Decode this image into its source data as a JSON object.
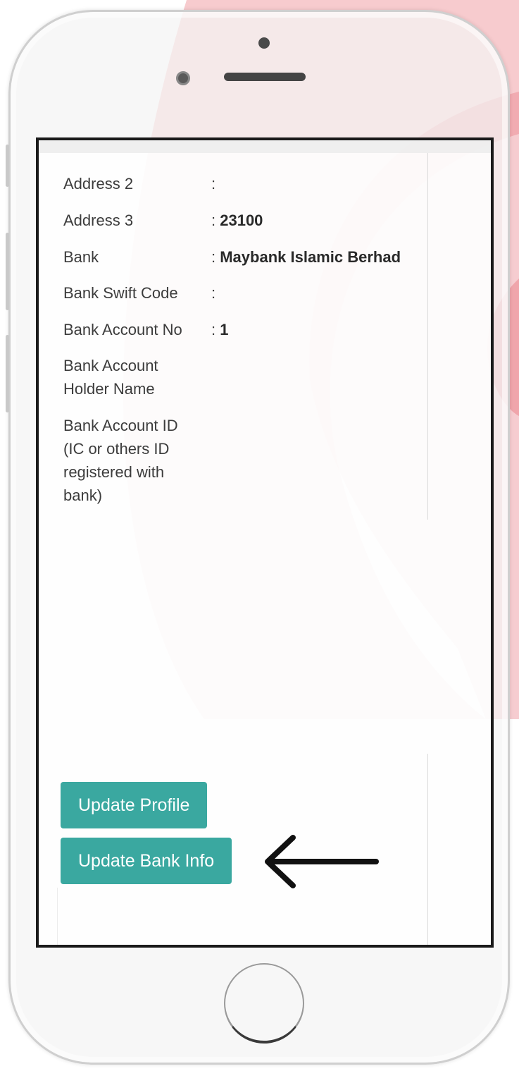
{
  "colors": {
    "button_bg": "#3aa8a0",
    "swirl": "#e8707a",
    "bezel": "#f4f4f4",
    "screen_border": "#1a1a1a",
    "arrow": "#111111"
  },
  "details": {
    "separator": ": ",
    "rows": [
      {
        "label": "Address 2",
        "value": ""
      },
      {
        "label": "Address 3",
        "value": "23100"
      },
      {
        "label": "Bank",
        "value": "Maybank Islamic Berhad"
      },
      {
        "label": "Bank Swift Code",
        "value": ""
      },
      {
        "label": "Bank Account No",
        "value": "1"
      },
      {
        "label_lines": [
          "Bank Account",
          "Holder Name"
        ],
        "value": ""
      },
      {
        "label_lines": [
          "Bank Account ID",
          "(IC or others ID",
          "registered with",
          "bank)"
        ],
        "value": ""
      }
    ]
  },
  "buttons": {
    "update_profile": "Update Profile",
    "update_bank_info": "Update Bank Info"
  },
  "icons": {
    "camera": "camera-dot-icon",
    "front_camera": "front-camera-icon",
    "speaker": "speaker-grille-icon",
    "home": "home-button-icon",
    "arrow": "arrow-left-icon"
  }
}
